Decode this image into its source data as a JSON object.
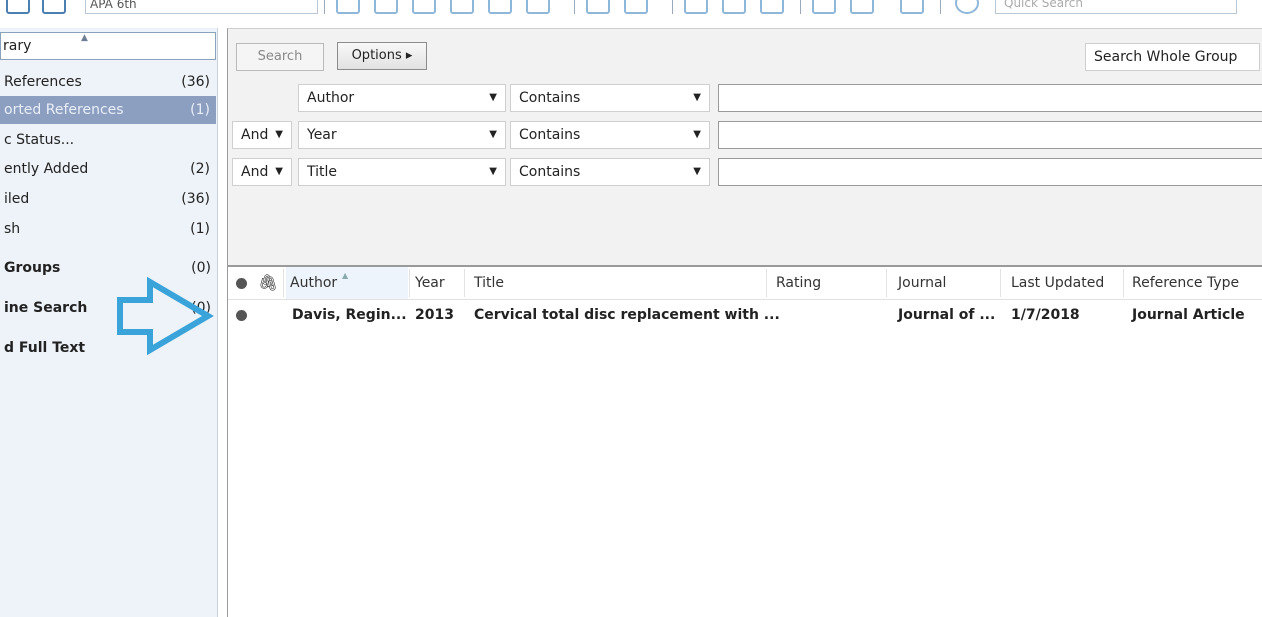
{
  "toolbar": {
    "style_value": "APA 6th",
    "quick_search_placeholder": "Quick Search"
  },
  "sidebar": {
    "header": "rary",
    "items": [
      {
        "label": "References",
        "count": "(36)"
      },
      {
        "label": "orted References",
        "count": "(1)"
      },
      {
        "label": "c Status...",
        "count": ""
      },
      {
        "label": "ently Added",
        "count": "(2)"
      },
      {
        "label": "iled",
        "count": "(36)"
      },
      {
        "label": "sh",
        "count": "(1)"
      }
    ],
    "groups": [
      {
        "label": "Groups",
        "count": "(0)"
      },
      {
        "label": "ine Search",
        "count": "(0)"
      },
      {
        "label": "d Full Text",
        "count": ""
      }
    ]
  },
  "search": {
    "search_label": "Search",
    "options_label": "Options ▸",
    "scope": "Search Whole Group",
    "rows": [
      {
        "bool": "",
        "field": "Author",
        "op": "Contains",
        "value": ""
      },
      {
        "bool": "And",
        "field": "Year",
        "op": "Contains",
        "value": ""
      },
      {
        "bool": "And",
        "field": "Title",
        "op": "Contains",
        "value": ""
      }
    ]
  },
  "list": {
    "columns": [
      "Author",
      "Year",
      "Title",
      "Rating",
      "Journal",
      "Last Updated",
      "Reference Type"
    ],
    "rows": [
      {
        "author": "Davis, Regin...",
        "year": "2013",
        "title": "Cervical total disc replacement with ...",
        "rating": "",
        "journal": "Journal of ...",
        "updated": "1/7/2018",
        "type": "Journal Article"
      }
    ]
  },
  "colors": {
    "selected": "#8d9fc0",
    "arrow": "#3aa4da",
    "sidebar_bg": "#eef3f9"
  },
  "icons": [
    "read-status-dot-icon",
    "paperclip-icon",
    "sort-ascending-icon",
    "dropdown-arrow-icon"
  ]
}
